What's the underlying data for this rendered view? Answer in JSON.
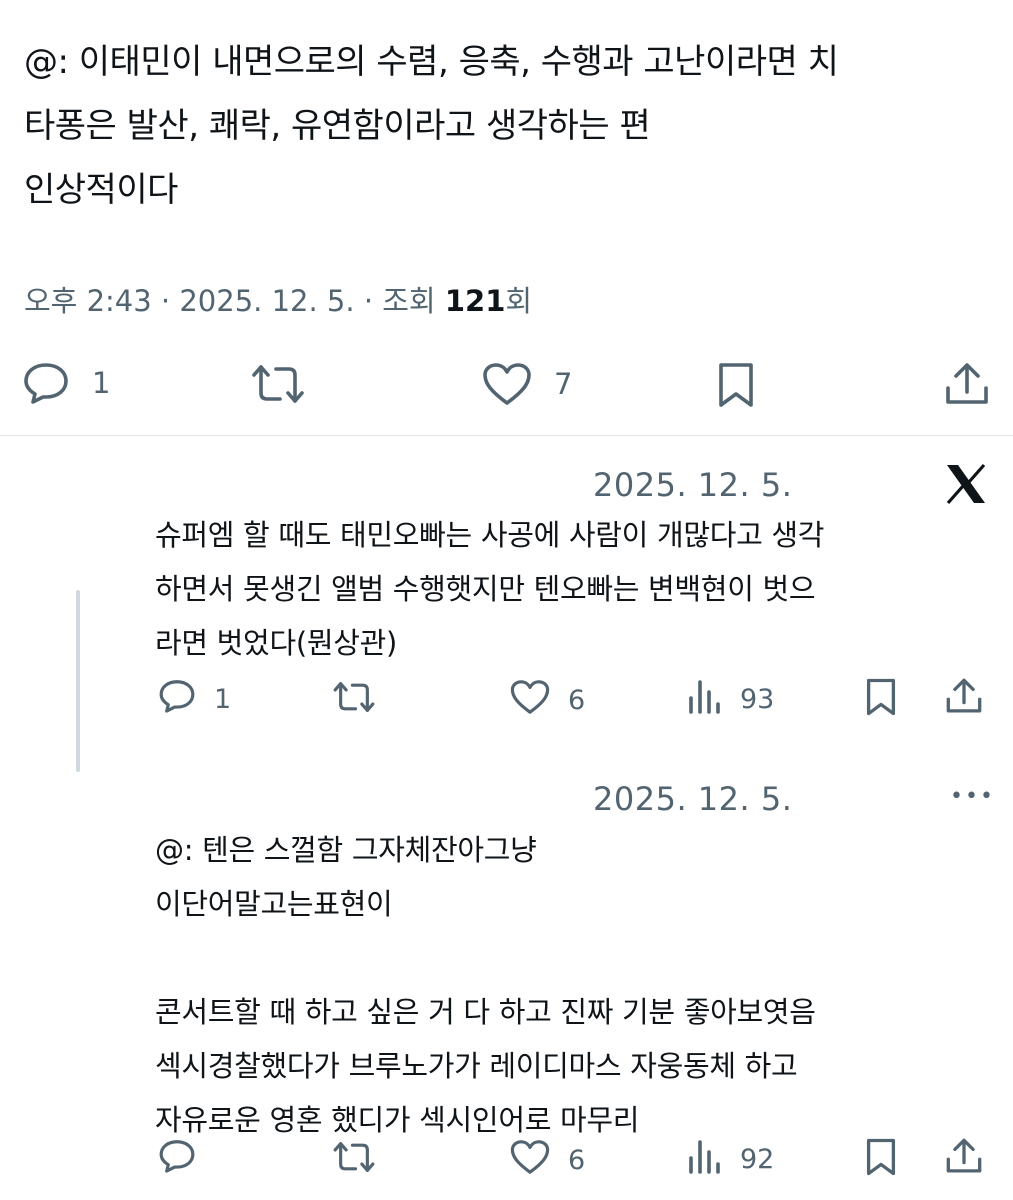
{
  "tweet": {
    "lines": [
      "@: 이태민이 내면으로의 수렴, 응축, 수행과 고난이라면 치",
      "타퐁은 발산, 쾌락, 유연함이라고 생각하는 편",
      "인상적이다"
    ],
    "meta_prefix": "오후 2:43 · 2025. 12. 5. · 조회 ",
    "views": "121",
    "views_suffix": "회",
    "actions": {
      "replies": "1",
      "likes": "7"
    }
  },
  "reply1": {
    "date": "2025. 12. 5.",
    "logo": "X",
    "lines": [
      "슈퍼엠 할 때도 태민오빠는 사공에 사람이 개많다고 생각",
      "하면서 못생긴 앨범 수행햇지만 텐오빠는 변백현이 벗으",
      "라면 벗었다(뭔상관)"
    ],
    "actions": {
      "replies": "1",
      "likes": "6",
      "views": "93"
    }
  },
  "reply2": {
    "date": "2025. 12. 5.",
    "more": "•••",
    "lines": [
      "@: 텐은 스껄함 그자체잔아그냥",
      "이단어말고는표현이",
      "",
      "콘서트할 때 하고 싶은 거 다 하고 진짜 기분 좋아보엿음",
      "섹시경찰했다가 브루노가가 레이디마스 자웅동체 하고",
      "자유로운 영혼 했디가 섹시인어로 마무리"
    ],
    "actions": {
      "likes": "6",
      "views": "92"
    }
  },
  "icons": [
    "reply-icon",
    "retweet-icon",
    "like-icon",
    "bookmark-icon",
    "share-icon",
    "views-icon",
    "x-logo-icon",
    "more-icon"
  ],
  "colors": {
    "text": "#0f1419",
    "secondary": "#536471",
    "divider": "#e6e6e6",
    "thread": "#cfd9de"
  }
}
